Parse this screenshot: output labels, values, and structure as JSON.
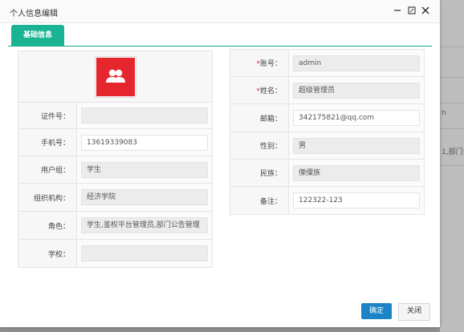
{
  "dialog": {
    "title": "个人信息编辑"
  },
  "tabs": [
    {
      "label": "基础信息"
    }
  ],
  "left_form": {
    "id_label": "证件号：",
    "id_value": "",
    "phone_label": "手机号：",
    "phone_value": "13619339083",
    "usergroup_label": "用户组：",
    "usergroup_value": "学生",
    "org_label": "组织机构：",
    "org_value": "经济学院",
    "role_label": "角色：",
    "role_value": "学生,鉴权平台管理员,部门公告管理",
    "school_label": "学校：",
    "school_value": ""
  },
  "right_form": {
    "account_req": "*",
    "account_label": "账号：",
    "account_value": "admin",
    "name_req": "*",
    "name_label": "姓名：",
    "name_value": "超级管理员",
    "email_label": "邮箱：",
    "email_value": "342175821@qq.com",
    "gender_label": "性别：",
    "gender_value": "男",
    "ethnic_label": "民族：",
    "ethnic_value": "傈僳族",
    "note_label": "备注：",
    "note_value": "122322-123"
  },
  "buttons": {
    "ok": "确定",
    "close": "关闭"
  },
  "background": {
    "frag1": "n",
    "frag2": "1,部门公"
  },
  "icons": {
    "avatar": "users-icon",
    "minimize": "minimize-icon",
    "maximize": "maximize-icon",
    "close": "close-icon"
  },
  "colors": {
    "tab": "#1ab394",
    "avatar": "#e5262d",
    "ok_button": "#1c84c6",
    "required": "#e5262d"
  }
}
